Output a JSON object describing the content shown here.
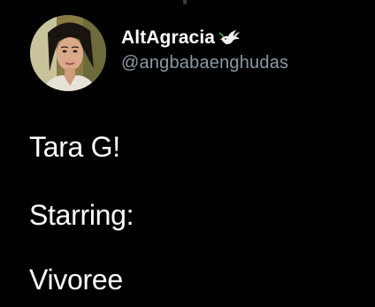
{
  "tweet": {
    "author": {
      "display_name": "AltAgracia",
      "badge_icon": "dove-icon",
      "handle": "@angbabaenghudas"
    },
    "body_lines": [
      "Tara G!",
      "Starring:",
      "Vivoree"
    ]
  },
  "colors": {
    "background": "#000000",
    "primary_text": "#ffffff",
    "secondary_text": "#8b98a5"
  }
}
